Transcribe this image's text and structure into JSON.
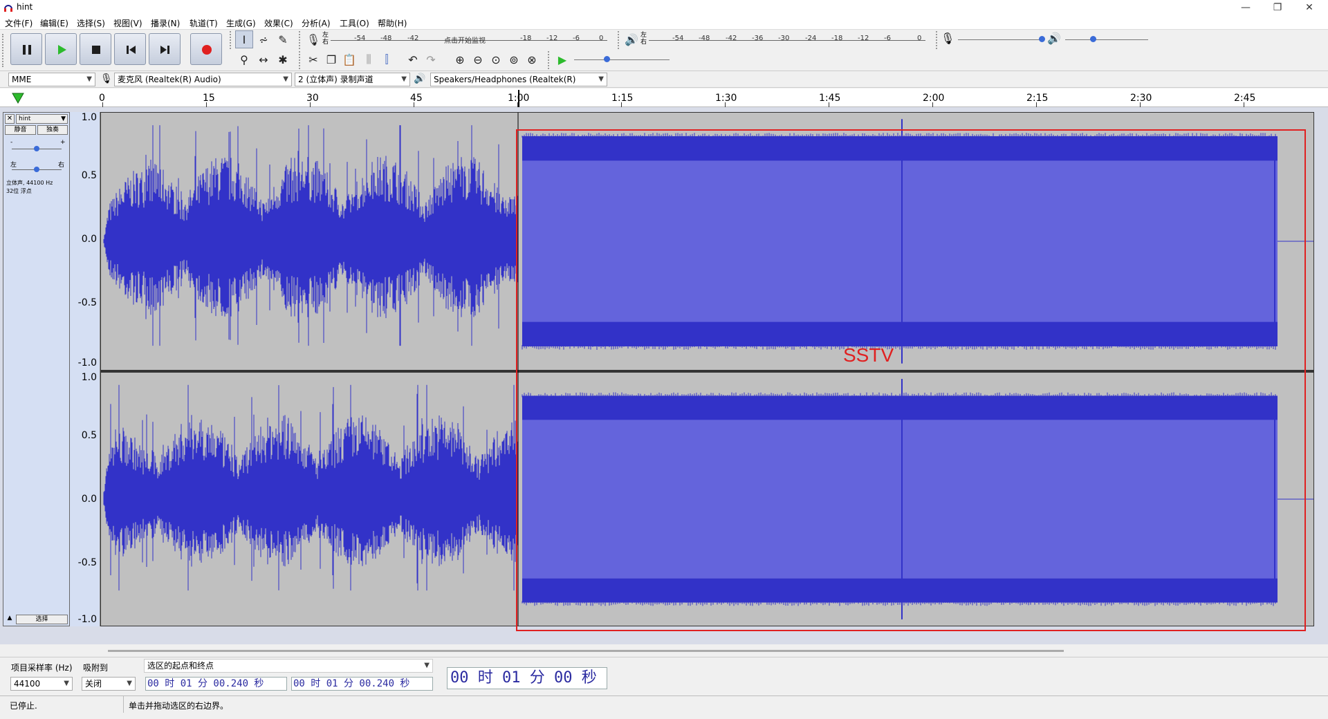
{
  "window": {
    "title": "hint",
    "minimize": "—",
    "maximize": "❐",
    "close": "✕"
  },
  "menu": [
    "文件(F)",
    "编辑(E)",
    "选择(S)",
    "视图(V)",
    "播录(N)",
    "轨道(T)",
    "生成(G)",
    "效果(C)",
    "分析(A)",
    "工具(O)",
    "帮助(H)"
  ],
  "transport": {
    "colors": {
      "play": "#2dbb2d",
      "record": "#e02020",
      "accent": "#3030c0"
    }
  },
  "record_meter": {
    "lr": "左\n右",
    "scale": [
      "-54",
      "-48",
      "-42",
      "点击开始监视",
      "-18",
      "-12",
      "-6",
      "0"
    ]
  },
  "play_meter": {
    "lr": "左\n右",
    "scale": [
      "-54",
      "-48",
      "-42",
      "-36",
      "-30",
      "-24",
      "-18",
      "-12",
      "-6",
      "0"
    ]
  },
  "device": {
    "host": "MME",
    "input": "麦克风 (Realtek(R) Audio)",
    "channels": "2 (立体声) 录制声道",
    "output": "Speakers/Headphones (Realtek(R)"
  },
  "ruler": {
    "ticks": [
      "0",
      "15",
      "30",
      "45",
      "1:00",
      "1:15",
      "1:30",
      "1:45",
      "2:00",
      "2:15",
      "2:30",
      "2:45"
    ]
  },
  "track": {
    "name": "hint",
    "mute": "静音",
    "solo": "独奏",
    "gain_minus": "-",
    "gain_plus": "+",
    "pan_left": "左",
    "pan_right": "右",
    "info1": "立体声, 44100 Hz",
    "info2": "32位 浮点",
    "select": "选择",
    "close": "✕",
    "collapse": "▲"
  },
  "vruler": [
    "1.0",
    "0.5",
    "0.0",
    "-0.5",
    "-1.0"
  ],
  "annotation": {
    "label": "SSTV",
    "color": "#e02020"
  },
  "waveform": {
    "color": "#3232c8",
    "selected_color": "#6464dc",
    "background": "#c0c0c0",
    "duration_s": 180,
    "signal_end_s": 170,
    "sstv_start_s": 60
  },
  "selection": {
    "rate_label": "项目采样率 (Hz)",
    "rate_value": "44100",
    "snap_label": "吸附到",
    "snap_value": "关闭",
    "range_label": "选区的起点和终点",
    "start_time": "00 时 01 分 00.240 秒",
    "end_time": "00 时 01 分 00.240 秒",
    "position": "00 时 01 分 00 秒"
  },
  "status": {
    "state": "已停止.",
    "hint": "单击并拖动选区的右边界。"
  }
}
